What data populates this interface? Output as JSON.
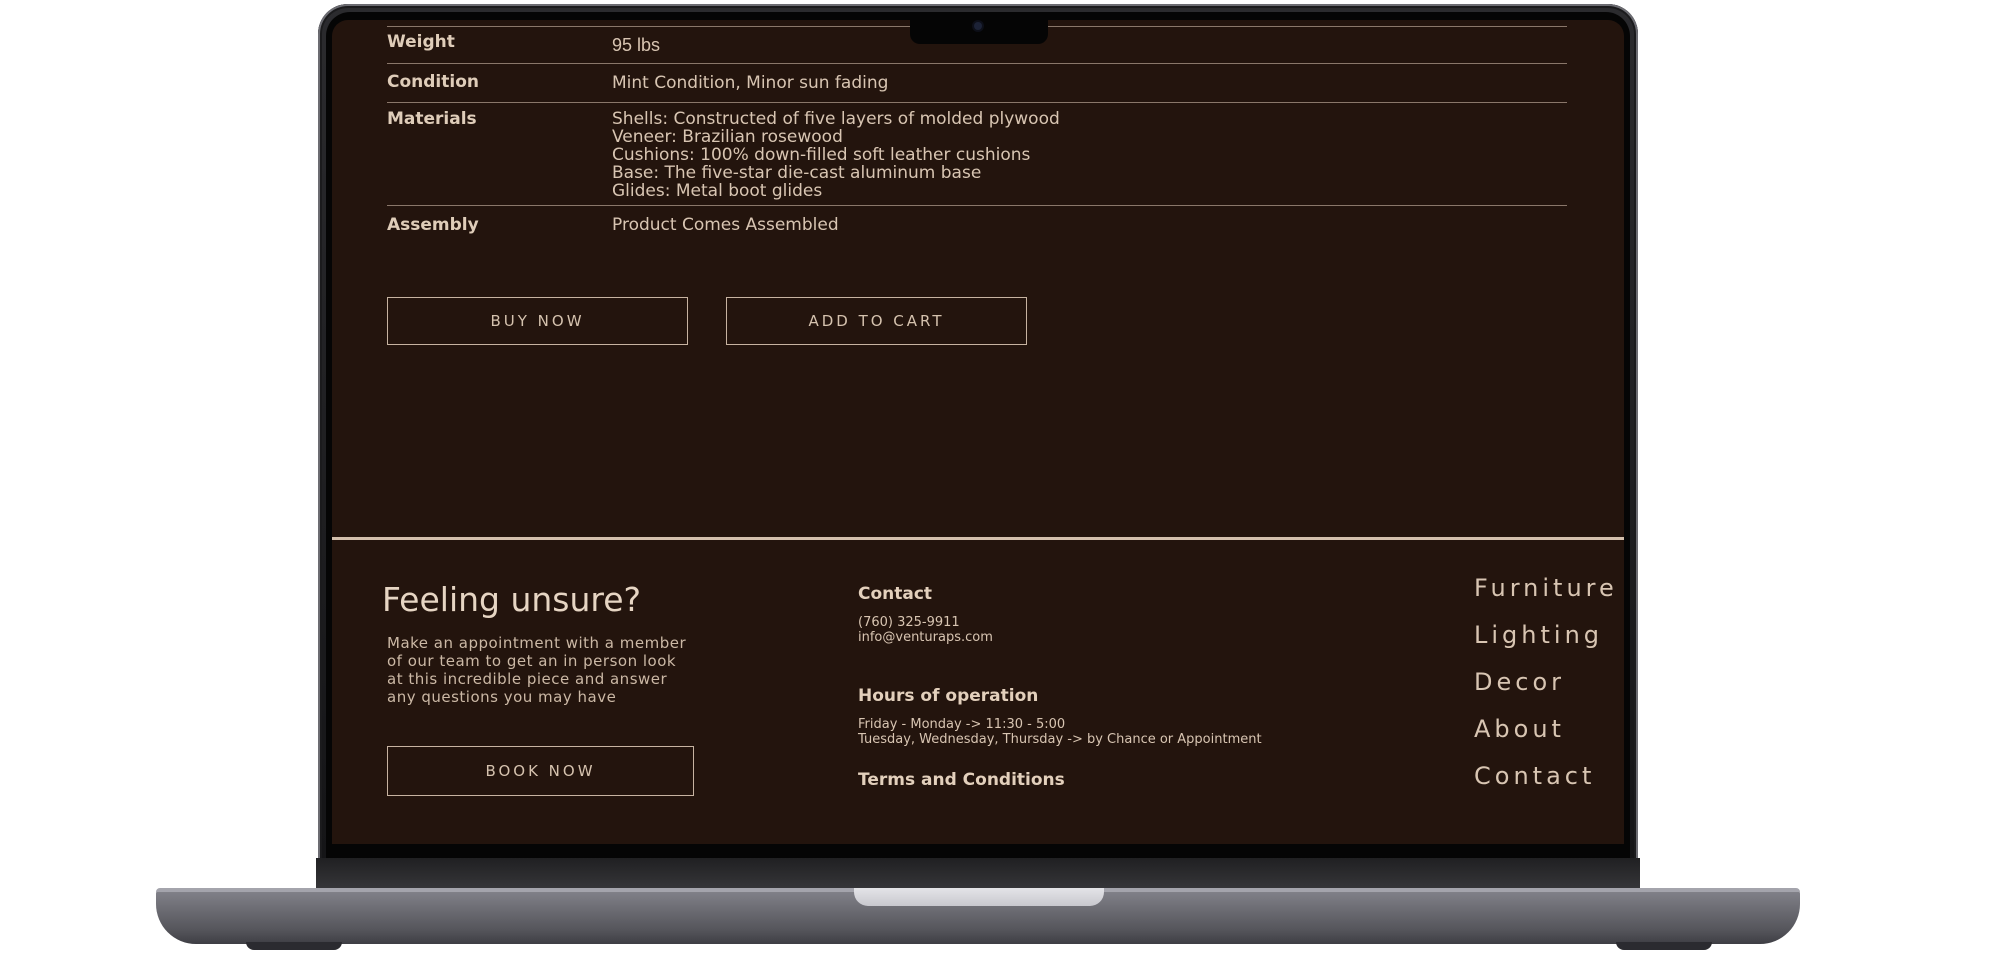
{
  "specs": [
    {
      "label": "Weight",
      "lines": [
        "95 lbs"
      ]
    },
    {
      "label": "Condition",
      "lines": [
        "Mint Condition, Minor sun fading"
      ]
    },
    {
      "label": "Materials",
      "lines": [
        "Shells: Constructed of five layers of molded plywood",
        "Veneer: Brazilian rosewood",
        "Cushions: 100% down-filled soft leather cushions",
        "Base: The five-star die-cast aluminum base",
        "Glides: Metal boot glides"
      ]
    },
    {
      "label": "Assembly",
      "lines": [
        "Product Comes Assembled"
      ]
    }
  ],
  "actions": {
    "buy_now": "BUY NOW",
    "add_to_cart": "ADD TO CART"
  },
  "footer": {
    "title": "Feeling unsure?",
    "description": "Make an appointment with a member of our team to get an in person look at this incredible piece and answer any questions you may have",
    "book_now": "BOOK NOW",
    "contact_heading": "Contact",
    "phone": "(760) 325-9911",
    "email": "info@venturaps.com",
    "hours_heading": "Hours of operation",
    "hours_line1": "Friday - Monday -> 11:30 - 5:00",
    "hours_line2": "Tuesday, Wednesday, Thursday -> by Chance or Appointment",
    "terms": "Terms and Conditions",
    "nav": [
      "Furniture",
      "Lighting",
      "Decor",
      "About",
      "Contact"
    ]
  },
  "colors": {
    "page_bg": "#23140d",
    "text": "#d9c6b2",
    "rule": "#d4c0ad"
  }
}
